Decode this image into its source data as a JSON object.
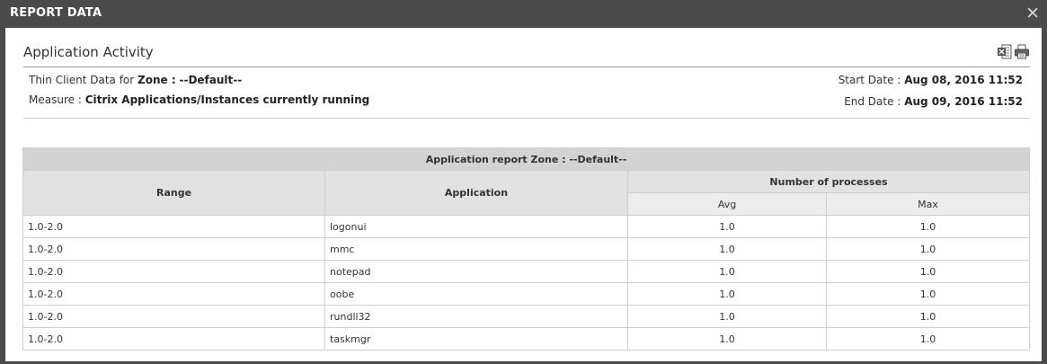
{
  "window": {
    "title": "REPORT DATA",
    "close_icon": "close-icon"
  },
  "heading": "Application Activity",
  "toolbar": {
    "icons": [
      "excel-export-icon",
      "print-icon"
    ]
  },
  "info": {
    "zone_prefix": "Thin Client Data for",
    "zone_label": "Zone :",
    "zone_value": "--Default--",
    "measure_label": "Measure :",
    "measure_value": "Citrix Applications/Instances currently running",
    "start_label": "Start Date :",
    "start_value": "Aug 08, 2016 11:52",
    "end_label": "End Date :",
    "end_value": "Aug 09, 2016 11:52"
  },
  "table": {
    "title": "Application report  Zone : --Default--",
    "headers": {
      "range": "Range",
      "application": "Application",
      "processes": "Number of processes",
      "avg": "Avg",
      "max": "Max"
    },
    "rows": [
      {
        "range": "1.0-2.0",
        "application": "logonui",
        "avg": "1.0",
        "max": "1.0"
      },
      {
        "range": "1.0-2.0",
        "application": "mmc",
        "avg": "1.0",
        "max": "1.0"
      },
      {
        "range": "1.0-2.0",
        "application": "notepad",
        "avg": "1.0",
        "max": "1.0"
      },
      {
        "range": "1.0-2.0",
        "application": "oobe",
        "avg": "1.0",
        "max": "1.0"
      },
      {
        "range": "1.0-2.0",
        "application": "rundll32",
        "avg": "1.0",
        "max": "1.0"
      },
      {
        "range": "1.0-2.0",
        "application": "taskmgr",
        "avg": "1.0",
        "max": "1.0"
      }
    ]
  }
}
